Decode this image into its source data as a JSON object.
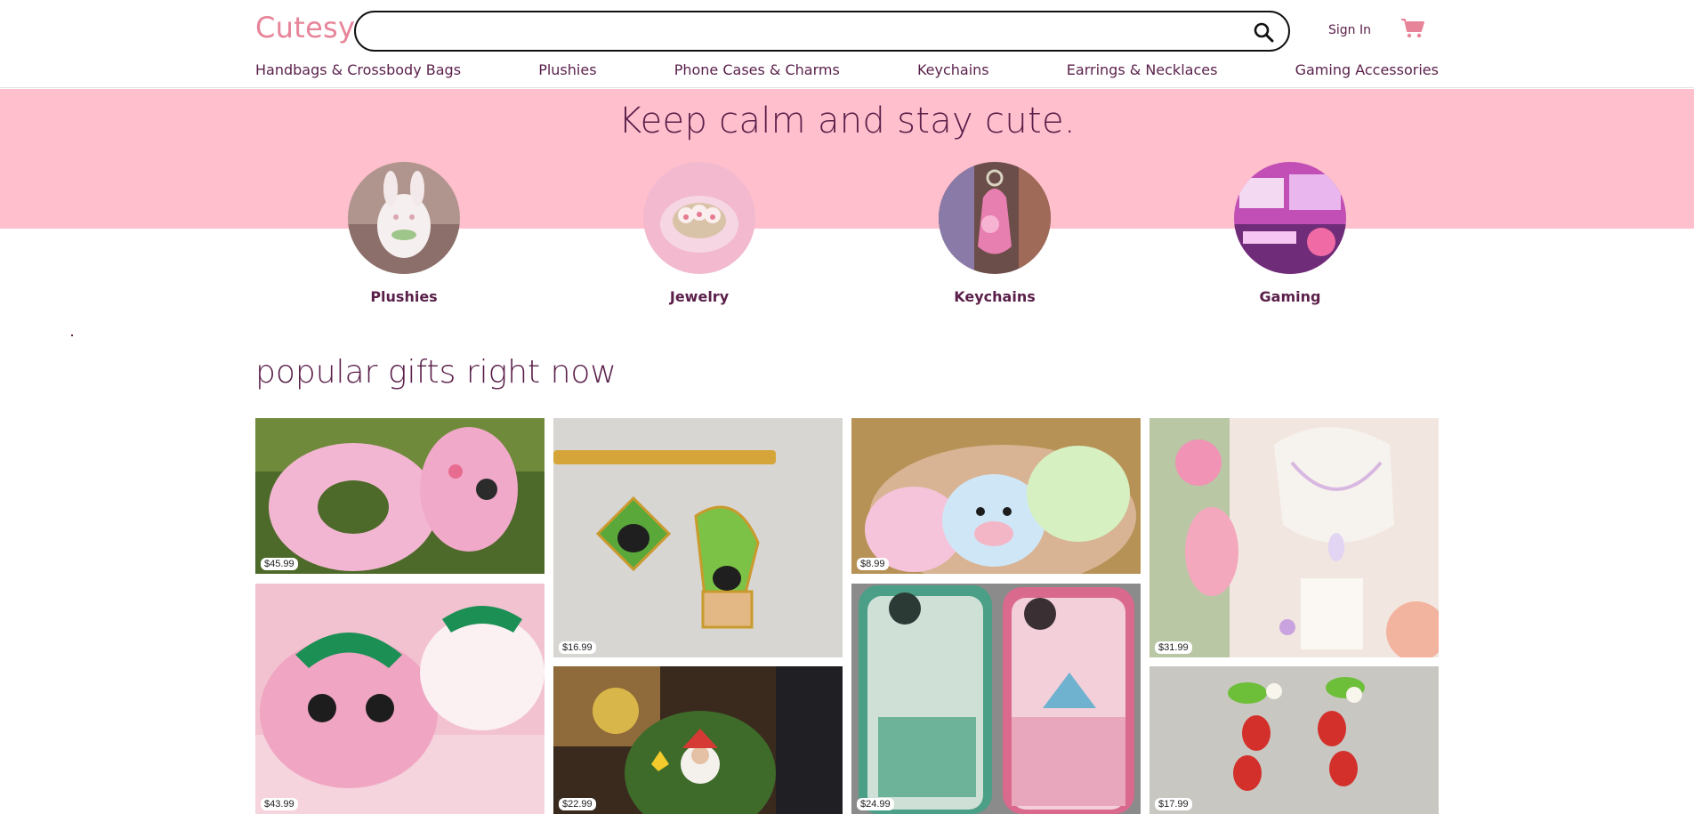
{
  "header": {
    "logo": "Cutesy",
    "search": {
      "placeholder": "",
      "value": ""
    },
    "signin_label": "Sign In",
    "cart_icon": "cart-icon"
  },
  "nav": {
    "items": [
      {
        "label": "Handbags & Crossbody Bags"
      },
      {
        "label": "Plushies"
      },
      {
        "label": "Phone Cases & Charms"
      },
      {
        "label": "Keychains"
      },
      {
        "label": "Earrings & Necklaces"
      },
      {
        "label": "Gaming Accessories"
      }
    ]
  },
  "hero": {
    "tagline": "Keep calm and stay cute.",
    "categories": [
      {
        "label": "Plushies"
      },
      {
        "label": "Jewelry"
      },
      {
        "label": "Keychains"
      },
      {
        "label": "Gaming"
      }
    ]
  },
  "popular": {
    "title": "popular gifts right now",
    "products": [
      {
        "price": "$45.99"
      },
      {
        "price": "$43.99"
      },
      {
        "price": "$16.99"
      },
      {
        "price": "$22.99"
      },
      {
        "price": "$8.99"
      },
      {
        "price": "$24.99"
      },
      {
        "price": "$31.99"
      },
      {
        "price": "$17.99"
      }
    ]
  },
  "colors": {
    "hero_bg": "#ffbfcc",
    "logo": "#e7849a",
    "text": "#5a1f4a"
  }
}
